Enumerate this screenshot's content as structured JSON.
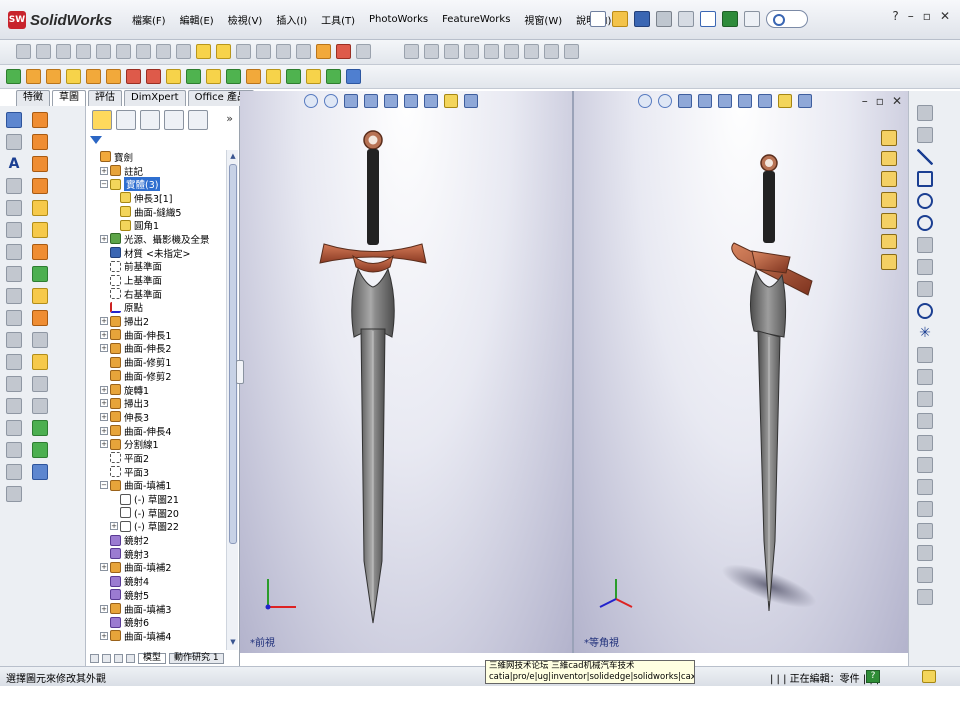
{
  "app": {
    "logo_mark": "SW",
    "logo_text": "SolidWorks"
  },
  "menu": [
    "檔案(F)",
    "編輯(E)",
    "檢視(V)",
    "插入(I)",
    "工具(T)",
    "PhotoWorks",
    "FeatureWorks",
    "視窗(W)",
    "說明(H)"
  ],
  "window_controls": [
    "?",
    "–",
    "▫",
    "✕"
  ],
  "command_manager_tabs": [
    {
      "label": "特徵",
      "active": false
    },
    {
      "label": "草圖",
      "active": true
    },
    {
      "label": "評估",
      "active": false
    },
    {
      "label": "DimXpert",
      "active": false
    },
    {
      "label": "Office 產品",
      "active": false
    }
  ],
  "tree": {
    "more_label": "»",
    "items": [
      {
        "label": "寶劍",
        "indent": 0,
        "exp": "",
        "icon": "part"
      },
      {
        "label": "註記",
        "indent": 1,
        "exp": "+",
        "icon": "feat"
      },
      {
        "label": "實體(3)",
        "indent": 1,
        "exp": "−",
        "icon": "folder",
        "selected": true
      },
      {
        "label": "伸長3[1]",
        "indent": 2,
        "exp": "",
        "icon": "folder"
      },
      {
        "label": "曲面-縫織5",
        "indent": 2,
        "exp": "",
        "icon": "folder"
      },
      {
        "label": "圓角1",
        "indent": 2,
        "exp": "",
        "icon": "folder"
      },
      {
        "label": "光源、攝影機及全景",
        "indent": 1,
        "exp": "+",
        "icon": "light"
      },
      {
        "label": "材質 <未指定>",
        "indent": 1,
        "exp": "",
        "icon": "material"
      },
      {
        "label": "前基準面",
        "indent": 1,
        "exp": "",
        "icon": "plane"
      },
      {
        "label": "上基準面",
        "indent": 1,
        "exp": "",
        "icon": "plane"
      },
      {
        "label": "右基準面",
        "indent": 1,
        "exp": "",
        "icon": "plane"
      },
      {
        "label": "原點",
        "indent": 1,
        "exp": "",
        "icon": "origin"
      },
      {
        "label": "掃出2",
        "indent": 1,
        "exp": "+",
        "icon": "feat"
      },
      {
        "label": "曲面-伸長1",
        "indent": 1,
        "exp": "+",
        "icon": "feat"
      },
      {
        "label": "曲面-伸長2",
        "indent": 1,
        "exp": "+",
        "icon": "feat"
      },
      {
        "label": "曲面-修剪1",
        "indent": 1,
        "exp": "",
        "icon": "feat"
      },
      {
        "label": "曲面-修剪2",
        "indent": 1,
        "exp": "",
        "icon": "feat"
      },
      {
        "label": "旋轉1",
        "indent": 1,
        "exp": "+",
        "icon": "feat"
      },
      {
        "label": "掃出3",
        "indent": 1,
        "exp": "+",
        "icon": "feat"
      },
      {
        "label": "伸長3",
        "indent": 1,
        "exp": "+",
        "icon": "feat"
      },
      {
        "label": "曲面-伸長4",
        "indent": 1,
        "exp": "+",
        "icon": "feat"
      },
      {
        "label": "分割線1",
        "indent": 1,
        "exp": "+",
        "icon": "feat"
      },
      {
        "label": "平面2",
        "indent": 1,
        "exp": "",
        "icon": "plane"
      },
      {
        "label": "平面3",
        "indent": 1,
        "exp": "",
        "icon": "plane"
      },
      {
        "label": "曲面-填補1",
        "indent": 1,
        "exp": "−",
        "icon": "feat"
      },
      {
        "label": "(-) 草圖21",
        "indent": 2,
        "exp": "",
        "icon": "sketch"
      },
      {
        "label": "(-) 草圖20",
        "indent": 2,
        "exp": "",
        "icon": "sketch"
      },
      {
        "label": "(-) 草圖22",
        "indent": 2,
        "exp": "+",
        "icon": "sketch"
      },
      {
        "label": "鏡射2",
        "indent": 1,
        "exp": "",
        "icon": "mirror"
      },
      {
        "label": "鏡射3",
        "indent": 1,
        "exp": "",
        "icon": "mirror"
      },
      {
        "label": "曲面-填補2",
        "indent": 1,
        "exp": "+",
        "icon": "feat"
      },
      {
        "label": "鏡射4",
        "indent": 1,
        "exp": "",
        "icon": "mirror"
      },
      {
        "label": "鏡射5",
        "indent": 1,
        "exp": "",
        "icon": "mirror"
      },
      {
        "label": "曲面-填補3",
        "indent": 1,
        "exp": "+",
        "icon": "feat"
      },
      {
        "label": "鏡射6",
        "indent": 1,
        "exp": "",
        "icon": "mirror"
      },
      {
        "label": "曲面-填補4",
        "indent": 1,
        "exp": "+",
        "icon": "feat"
      }
    ]
  },
  "bottom_tabs": [
    {
      "label": "模型",
      "active": true
    },
    {
      "label": "動作研究 1",
      "active": false
    }
  ],
  "viewports": {
    "front_label": "*前視",
    "iso_label": "*等角視",
    "close_controls": [
      "–",
      "▫",
      "✕"
    ]
  },
  "status": {
    "left_text": "選擇圖元來修改其外觀",
    "tooltip_line1": "三維网技术论坛 三維cad机械汽车技术",
    "tooltip_line2": "catia|pro/e|ug|inventor|solidedge|solidworks|caxa - Pow",
    "right_text": "| | | 正在編輯：零件 | | |",
    "help_glyph": "?"
  },
  "colors": {
    "accent": "#2f6fd0",
    "blade": "#7d7d7d",
    "guard": "#b3583a",
    "grip": "#222222",
    "tooltip_bg": "#ffffe1"
  }
}
